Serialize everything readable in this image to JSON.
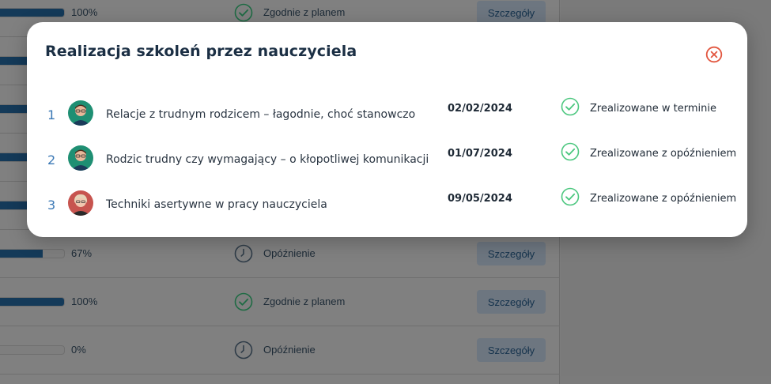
{
  "background_table": {
    "rows": [
      {
        "percent": "100%",
        "progress": 1.0,
        "status": "Zgodnie z planem",
        "status_kind": "ok",
        "button": "Szczegóły"
      },
      {
        "percent": "",
        "progress": 1.0,
        "status": "",
        "status_kind": "",
        "button": ""
      },
      {
        "percent": "",
        "progress": 1.0,
        "status": "",
        "status_kind": "",
        "button": ""
      },
      {
        "percent": "",
        "progress": 1.0,
        "status": "",
        "status_kind": "",
        "button": ""
      },
      {
        "percent": "",
        "progress": 1.0,
        "status": "",
        "status_kind": "",
        "button": ""
      },
      {
        "percent": "67%",
        "progress": 0.67,
        "status": "Opóźnienie",
        "status_kind": "delay",
        "button": "Szczegóły"
      },
      {
        "percent": "100%",
        "progress": 1.0,
        "status": "Zgodnie z planem",
        "status_kind": "ok",
        "button": "Szczegóły"
      },
      {
        "percent": "0%",
        "progress": 0.0,
        "status": "Opóźnienie",
        "status_kind": "delay",
        "button": "Szczegóły"
      }
    ]
  },
  "modal": {
    "title": "Realizacja szkoleń przez nauczyciela",
    "close_icon": "close-circle-icon",
    "rows": [
      {
        "number": "1",
        "avatar": "teacher-avatar-male",
        "name": "Relacje z trudnym rodzicem – łagodnie, choć stanowczo",
        "date": "02/02/2024",
        "status": "Zrealizowane w terminie",
        "status_icon": "check-circle-icon"
      },
      {
        "number": "2",
        "avatar": "teacher-avatar-male",
        "name": "Rodzic trudny czy wymagający – o kłopotliwej komunikacji",
        "date": "01/07/2024",
        "status": "Zrealizowane z opóźnieniem",
        "status_icon": "check-circle-icon"
      },
      {
        "number": "3",
        "avatar": "teacher-avatar-female",
        "name": "Techniki asertywne w pracy nauczyciela",
        "date": "09/05/2024",
        "status": "Zrealizowane z opóźnieniem",
        "status_icon": "check-circle-icon"
      }
    ]
  },
  "colors": {
    "accent_blue": "#3a78b5",
    "check_green": "#4cc77f",
    "close_red": "#e2563f",
    "title_dark": "#1b2f44"
  }
}
